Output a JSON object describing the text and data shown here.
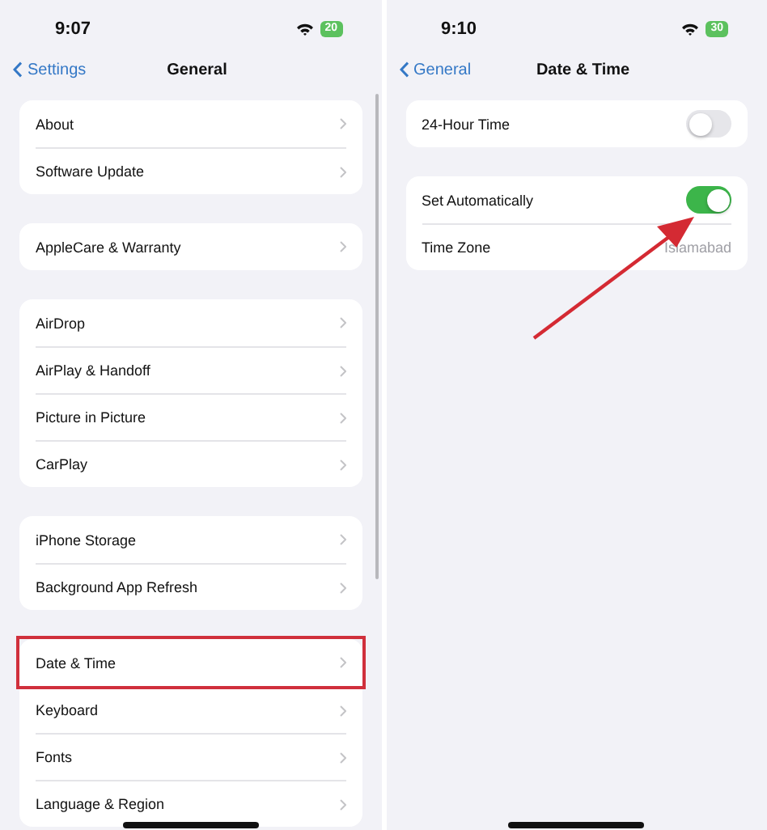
{
  "panels": [
    {
      "status": {
        "time": "9:07",
        "battery": "20"
      },
      "nav": {
        "back": "Settings",
        "title": "General"
      },
      "scrollbar": true,
      "annotation_arrow": false,
      "groups": [
        [
          {
            "kind": "link",
            "label": "About",
            "highlighted": false
          },
          {
            "kind": "link",
            "label": "Software Update",
            "highlighted": false
          }
        ],
        [
          {
            "kind": "link",
            "label": "AppleCare & Warranty",
            "highlighted": false
          }
        ],
        [
          {
            "kind": "link",
            "label": "AirDrop",
            "highlighted": false
          },
          {
            "kind": "link",
            "label": "AirPlay & Handoff",
            "highlighted": false
          },
          {
            "kind": "link",
            "label": "Picture in Picture",
            "highlighted": false
          },
          {
            "kind": "link",
            "label": "CarPlay",
            "highlighted": false
          }
        ],
        [
          {
            "kind": "link",
            "label": "iPhone Storage",
            "highlighted": false
          },
          {
            "kind": "link",
            "label": "Background App Refresh",
            "highlighted": false
          }
        ],
        [
          {
            "kind": "link",
            "label": "Date & Time",
            "highlighted": true
          },
          {
            "kind": "link",
            "label": "Keyboard",
            "highlighted": false
          },
          {
            "kind": "link",
            "label": "Fonts",
            "highlighted": false
          },
          {
            "kind": "link",
            "label": "Language & Region",
            "highlighted": false
          }
        ]
      ]
    },
    {
      "status": {
        "time": "9:10",
        "battery": "30"
      },
      "nav": {
        "back": "General",
        "title": "Date & Time"
      },
      "scrollbar": false,
      "annotation_arrow": true,
      "groups": [
        [
          {
            "kind": "toggle",
            "label": "24-Hour Time",
            "on": false
          }
        ],
        [
          {
            "kind": "toggle",
            "label": "Set Automatically",
            "on": true
          },
          {
            "kind": "value",
            "label": "Time Zone",
            "value": "Islamabad"
          }
        ]
      ]
    }
  ]
}
